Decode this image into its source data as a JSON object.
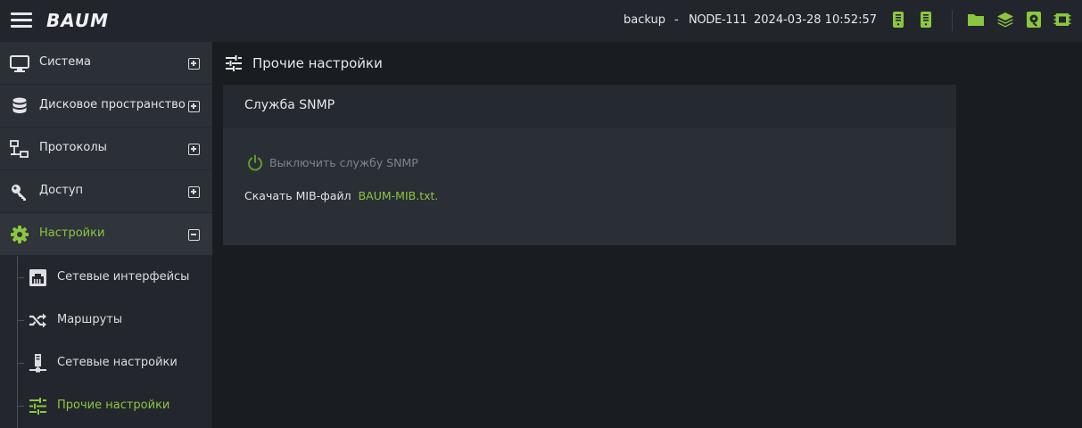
{
  "colors": {
    "accent": "#8cc63e",
    "topbar_bg": "#22262c",
    "sidebar_bg": "#2b2f36",
    "page_bg": "#191c21",
    "panel_bg": "#2a2e35"
  },
  "topbar": {
    "logo_text": "BAUM",
    "mode": "backup",
    "separator": "-",
    "node": "NODE-111",
    "datetime": "2024-03-28 10:52:57",
    "icons": [
      "server-icon",
      "server-icon",
      "folder-icon",
      "layers-icon",
      "disk-icon",
      "memory-icon"
    ]
  },
  "sidebar": {
    "items": [
      {
        "label": "Система",
        "icon": "monitor-icon",
        "expanded": false
      },
      {
        "label": "Дисковое пространство",
        "icon": "database-icon",
        "expanded": false
      },
      {
        "label": "Протоколы",
        "icon": "network-icon",
        "expanded": false
      },
      {
        "label": "Доступ",
        "icon": "key-icon",
        "expanded": false
      },
      {
        "label": "Настройки",
        "icon": "gear-icon",
        "expanded": true
      }
    ],
    "subitems": [
      {
        "label": "Сетевые интерфейсы",
        "icon": "ethernet-icon"
      },
      {
        "label": "Маршруты",
        "icon": "shuffle-icon"
      },
      {
        "label": "Сетевые настройки",
        "icon": "network-tower-icon"
      },
      {
        "label": "Прочие настройки",
        "icon": "sliders-icon",
        "active": true
      }
    ]
  },
  "main": {
    "title": "Прочие настройки",
    "panel": {
      "title": "Служба SNMP",
      "toggle_label": "Выключить службу SNMP",
      "download_prefix": "Скачать MIB-файл",
      "download_link": "BAUM-MIB.txt",
      "download_suffix": "."
    }
  }
}
